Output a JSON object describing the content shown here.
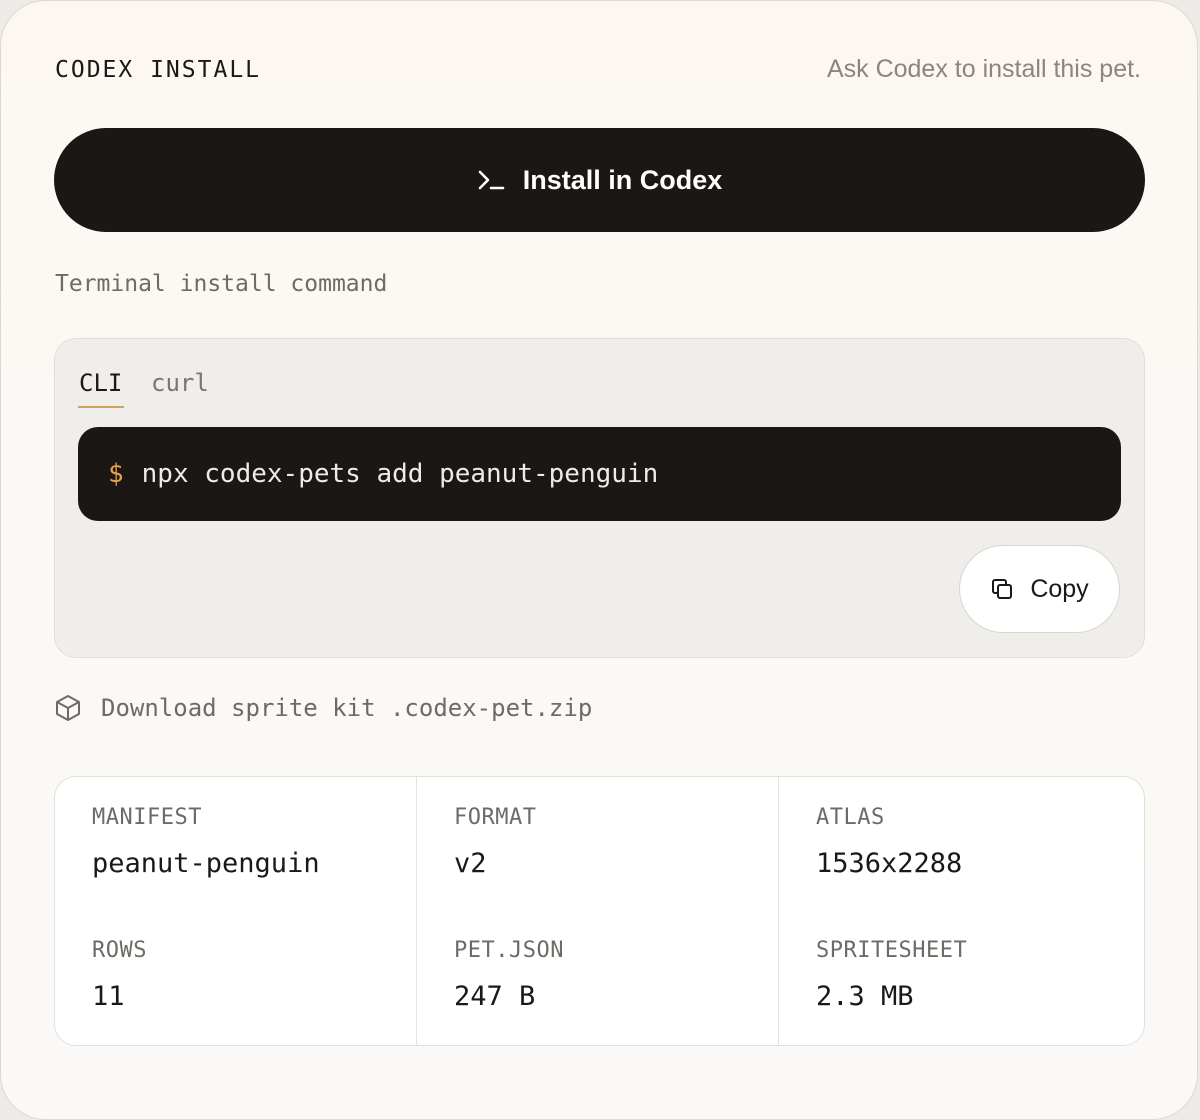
{
  "header": {
    "title": "CODEX INSTALL",
    "subtitle": "Ask Codex to install this pet."
  },
  "install_button": {
    "label": "Install in Codex",
    "icon": "terminal-icon"
  },
  "terminal": {
    "label": "Terminal install command",
    "tabs": [
      "CLI",
      "curl"
    ],
    "active_tab": "CLI",
    "prompt": "$",
    "command": "npx codex-pets add peanut-penguin",
    "copy_label": "Copy"
  },
  "download": {
    "icon": "package-icon",
    "label": "Download sprite kit .codex-pet.zip"
  },
  "meta": {
    "manifest_label": "MANIFEST",
    "manifest_value": "peanut-penguin",
    "format_label": "FORMAT",
    "format_value": "v2",
    "atlas_label": "ATLAS",
    "atlas_value": "1536x2288",
    "rows_label": "ROWS",
    "rows_value": "11",
    "petjson_label": "PET.JSON",
    "petjson_value": "247 B",
    "spritesheet_label": "SPRITESHEET",
    "spritesheet_value": "2.3 MB"
  },
  "colors": {
    "accent": "#e7a24a",
    "dark": "#1a1714"
  }
}
